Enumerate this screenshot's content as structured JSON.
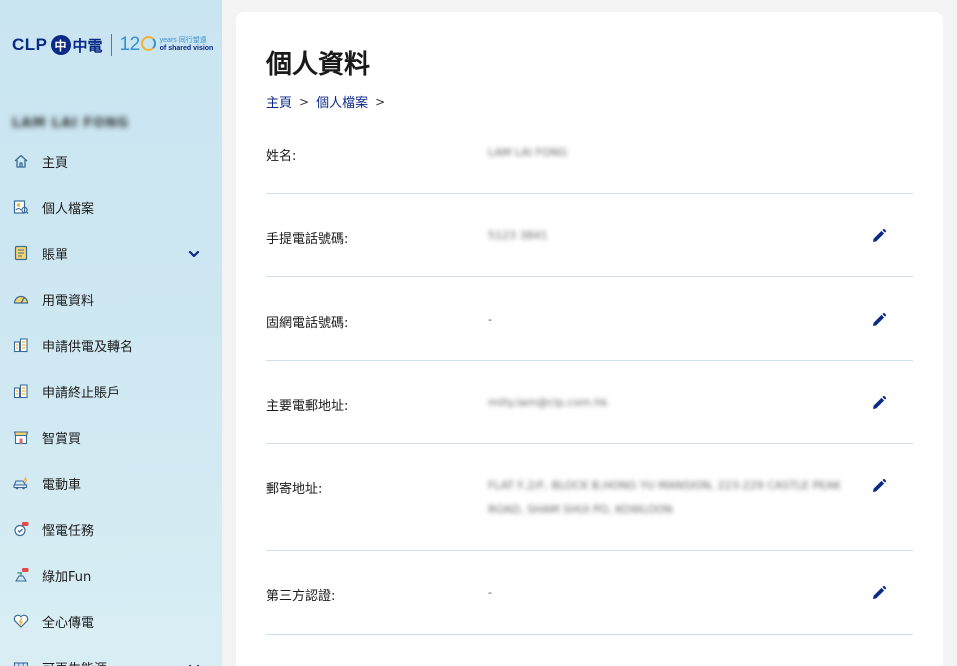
{
  "logo": {
    "brand": "CLP",
    "mark": "中",
    "brand_cn": "中電",
    "anniversary_prefix": "12",
    "tagline_top": "years 同行望遠",
    "tagline_bottom": "of shared vision"
  },
  "sidebar": {
    "user_name": "LAM LAI FONG",
    "items": [
      {
        "label": "主頁",
        "icon": "home-icon"
      },
      {
        "label": "個人檔案",
        "icon": "profile-icon"
      },
      {
        "label": "賬單",
        "icon": "bill-icon",
        "expandable": true
      },
      {
        "label": "用電資料",
        "icon": "gauge-icon"
      },
      {
        "label": "申請供電及轉名",
        "icon": "building-icon"
      },
      {
        "label": "申請終止賬戶",
        "icon": "building-icon"
      },
      {
        "label": "智賞買",
        "icon": "shop-icon"
      },
      {
        "label": "電動車",
        "icon": "ev-car-icon"
      },
      {
        "label": "慳電任務",
        "icon": "mission-icon"
      },
      {
        "label": "綠加Fun",
        "icon": "green-fun-icon"
      },
      {
        "label": "全心傳電",
        "icon": "heart-icon"
      },
      {
        "label": "可再生能源",
        "icon": "renewable-icon",
        "expandable": true
      }
    ]
  },
  "main": {
    "title": "個人資料",
    "breadcrumb": [
      "主頁",
      "個人檔案"
    ],
    "breadcrumb_sep": ">",
    "fields": [
      {
        "label": "姓名:",
        "value": "LAM LAI FONG",
        "blurred": true,
        "editable": false
      },
      {
        "label": "手提電話號碼:",
        "value": "5123 3841",
        "blurred": true,
        "editable": true
      },
      {
        "label": "固網電話號碼:",
        "value": "-",
        "blurred": false,
        "editable": true
      },
      {
        "label": "主要電郵地址:",
        "value": "milly.lam@clp.com.hk",
        "blurred": true,
        "editable": true
      },
      {
        "label": "郵寄地址:",
        "value": "FLAT F,2/F, BLOCK B,HONG YU MANSION, 223-229 CASTLE PEAK ROAD, SHAM SHUI PO, KOWLOON",
        "blurred": true,
        "editable": true
      },
      {
        "label": "第三方認證:",
        "value": "-",
        "blurred": false,
        "editable": true
      }
    ]
  },
  "colors": {
    "brand_navy": "#0b2a86",
    "sidebar_bg": "#c9e5f1",
    "divider": "#cfdfec",
    "accent_blue": "#3a8fd0",
    "accent_gold": "#f2b234"
  }
}
